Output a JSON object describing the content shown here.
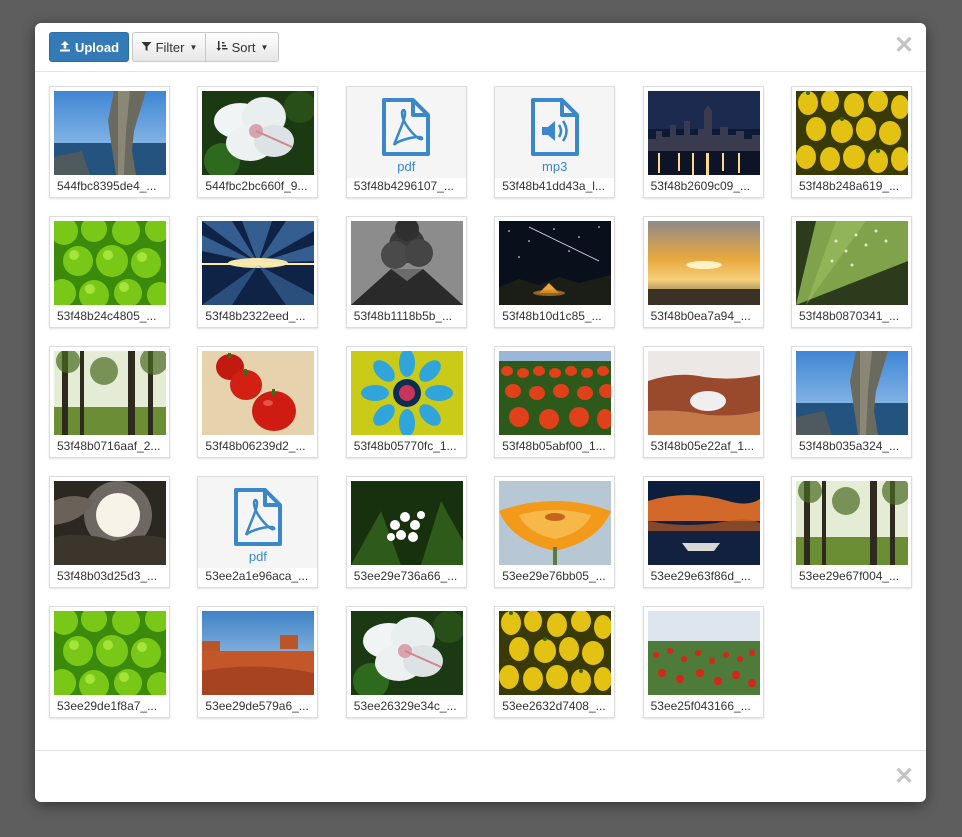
{
  "toolbar": {
    "upload_label": "Upload",
    "filter_label": "Filter",
    "sort_label": "Sort"
  },
  "files": [
    {
      "name": "544fbc8395de4_...",
      "thumb": "coast-rock"
    },
    {
      "name": "544fbc2bc660f_9...",
      "thumb": "white-hibiscus"
    },
    {
      "name": "53f48b4296107_...",
      "thumb": "pdf"
    },
    {
      "name": "53f48b41dd43a_l...",
      "thumb": "mp3"
    },
    {
      "name": "53f48b2609c09_...",
      "thumb": "city-night"
    },
    {
      "name": "53f48b248a619_...",
      "thumb": "yellow-tomatoes"
    },
    {
      "name": "53f48b24c4805_...",
      "thumb": "green-bushes"
    },
    {
      "name": "53f48b2322eed_...",
      "thumb": "sky-reflection"
    },
    {
      "name": "53f48b1118b5b_...",
      "thumb": "volcano"
    },
    {
      "name": "53f48b10d1c85_...",
      "thumb": "night-tent"
    },
    {
      "name": "53f48b0ea7a94_...",
      "thumb": "sunset-clouds"
    },
    {
      "name": "53f48b0870341_...",
      "thumb": "leaf-dew"
    },
    {
      "name": "53f48b0716aaf_2...",
      "thumb": "forest"
    },
    {
      "name": "53f48b06239d2_...",
      "thumb": "red-tomatoes"
    },
    {
      "name": "53f48b05770fc_1...",
      "thumb": "blue-flower"
    },
    {
      "name": "53f48b05abf00_1...",
      "thumb": "tulip-field"
    },
    {
      "name": "53f48b05e22af_1...",
      "thumb": "rock-arch"
    },
    {
      "name": "53f48b035a324_...",
      "thumb": "coast-rock"
    },
    {
      "name": "53f48b03d25d3_...",
      "thumb": "sun-clouds"
    },
    {
      "name": "53ee2a1e96aca_...",
      "thumb": "pdf"
    },
    {
      "name": "53ee29e736a66_...",
      "thumb": "white-flowers"
    },
    {
      "name": "53ee29e76bb05_...",
      "thumb": "orange-flower"
    },
    {
      "name": "53ee29e63f86d_...",
      "thumb": "lake-boat"
    },
    {
      "name": "53ee29e67f004_...",
      "thumb": "forest"
    },
    {
      "name": "53ee29de1f8a7_...",
      "thumb": "green-bushes"
    },
    {
      "name": "53ee29de579a6_...",
      "thumb": "desert-valley"
    },
    {
      "name": "53ee26329e34c_...",
      "thumb": "white-hibiscus"
    },
    {
      "name": "53ee2632d7408_...",
      "thumb": "yellow-tomatoes"
    },
    {
      "name": "53ee25f043166_...",
      "thumb": "poppy-field"
    }
  ],
  "file_type_labels": {
    "pdf": "pdf",
    "mp3": "mp3"
  },
  "colors": {
    "primary": "#337ab7",
    "file_icon": "#3a87c9",
    "close_icon": "#c4c4c4"
  }
}
